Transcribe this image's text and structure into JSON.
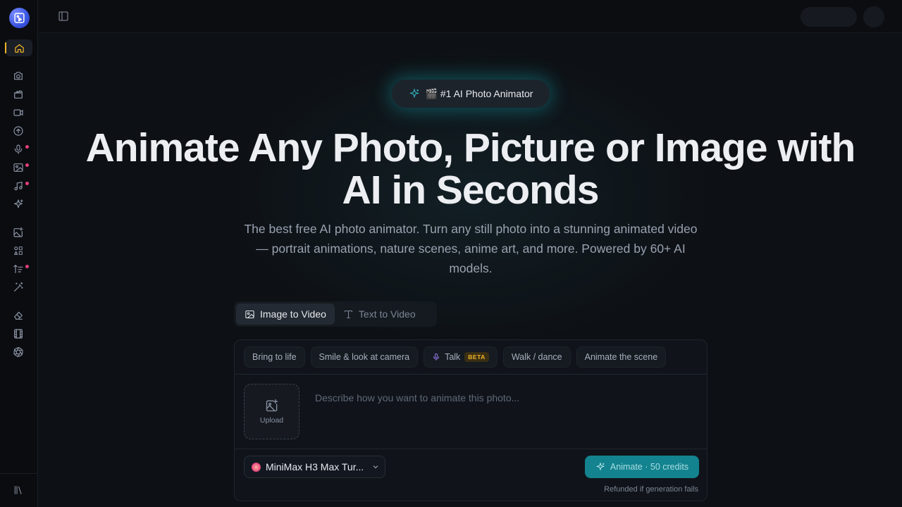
{
  "sidebar": {
    "items": [
      {
        "icon": "home-icon",
        "active": true,
        "dot": false
      },
      {
        "icon": "camera-icon",
        "dot": false
      },
      {
        "icon": "clapperboard-icon",
        "dot": false
      },
      {
        "icon": "video-icon",
        "dot": false
      },
      {
        "icon": "upload-circle-icon",
        "dot": false
      },
      {
        "icon": "microphone-icon",
        "dot": true
      },
      {
        "icon": "image-icon",
        "dot": true
      },
      {
        "icon": "music-icon",
        "dot": true
      },
      {
        "icon": "sparkles-icon",
        "dot": false
      },
      {
        "icon": "image-plus-icon",
        "dot": false
      },
      {
        "icon": "shapes-icon",
        "dot": false
      },
      {
        "icon": "sort-list-icon",
        "dot": true
      },
      {
        "icon": "magic-wand-icon",
        "dot": false
      },
      {
        "icon": "eraser-icon",
        "dot": false
      },
      {
        "icon": "film-icon",
        "dot": false
      },
      {
        "icon": "aperture-icon",
        "dot": false
      }
    ],
    "bottom_icon": "library-icon"
  },
  "hero": {
    "badge": "🎬 #1 AI Photo Animator",
    "headline": "Animate Any Photo, Picture or Image with AI in Seconds",
    "subtext": "The best free AI photo animator. Turn any still photo into a stunning animated video — portrait animations, nature scenes, anime art, and more. Powered by 60+ AI models."
  },
  "tabs": [
    {
      "label": "Image to Video",
      "active": true
    },
    {
      "label": "Text to Video",
      "active": false
    }
  ],
  "chips": [
    {
      "label": "Bring to life"
    },
    {
      "label": "Smile & look at camera"
    },
    {
      "label": "Talk",
      "badge": "BETA"
    },
    {
      "label": "Walk / dance"
    },
    {
      "label": "Animate the scene"
    }
  ],
  "upload": {
    "label": "Upload"
  },
  "prompt": {
    "placeholder": "Describe how you want to animate this photo...",
    "value": ""
  },
  "model": {
    "label": "MiniMax H3 Max Tur..."
  },
  "animate_button": {
    "label": "Animate · 50 credits"
  },
  "refund_note": "Refunded if generation fails",
  "colors": {
    "accent": "#f0b429",
    "primary_button": "#13838f",
    "notification_dot": "#e4407a",
    "background": "#0d1014"
  }
}
